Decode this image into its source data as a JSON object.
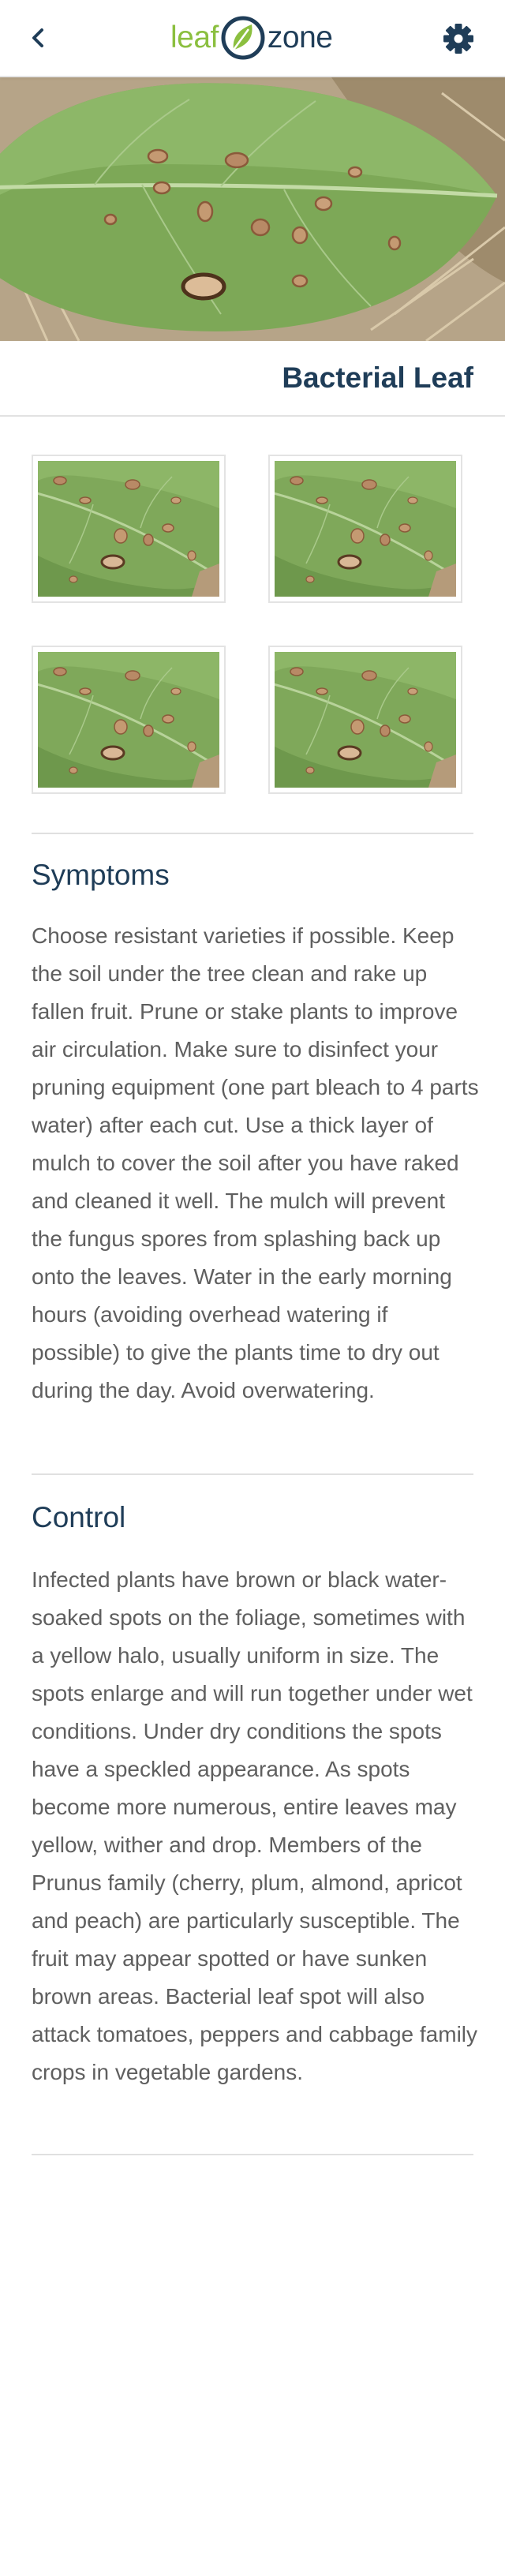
{
  "app": {
    "logo_left": "leaf",
    "logo_right": "zone",
    "brand_green": "#8bbf3f",
    "brand_navy": "#1f3d58"
  },
  "header": {
    "back_icon": "chevron-left-icon",
    "settings_icon": "gear-icon"
  },
  "page": {
    "title": "Bacterial Leaf"
  },
  "gallery": {
    "thumbnail_count": 4
  },
  "sections": [
    {
      "heading": "Symptoms",
      "body": "Choose resistant varieties if possible. Keep the soil under the tree clean and rake up fallen fruit. Prune or stake plants to improve air circulation. Make sure to disinfect your pruning equipment (one part bleach to 4 parts water) after each cut. Use a thick layer of mulch to cover the soil after you have raked and cleaned it well. The mulch will prevent the fungus spores from splashing back up onto the leaves. Water in the early morning hours (avoiding overhead watering if possible) to give the plants time to dry out during the day. Avoid overwatering."
    },
    {
      "heading": "Control",
      "body": "Infected plants have brown or black water-soaked spots on the foliage, sometimes with a yellow halo, usually uniform in size. The spots enlarge and will run together under wet conditions. Under dry conditions the spots have a speckled appearance. As spots become more numerous, entire leaves may yellow, wither and drop. Members of the Prunus family (cherry, plum, almond, apricot and peach) are particularly susceptible. The fruit may appear spotted or have sunken brown areas. Bacterial leaf spot will also attack tomatoes, peppers and cabbage family crops in vegetable gardens."
    }
  ]
}
